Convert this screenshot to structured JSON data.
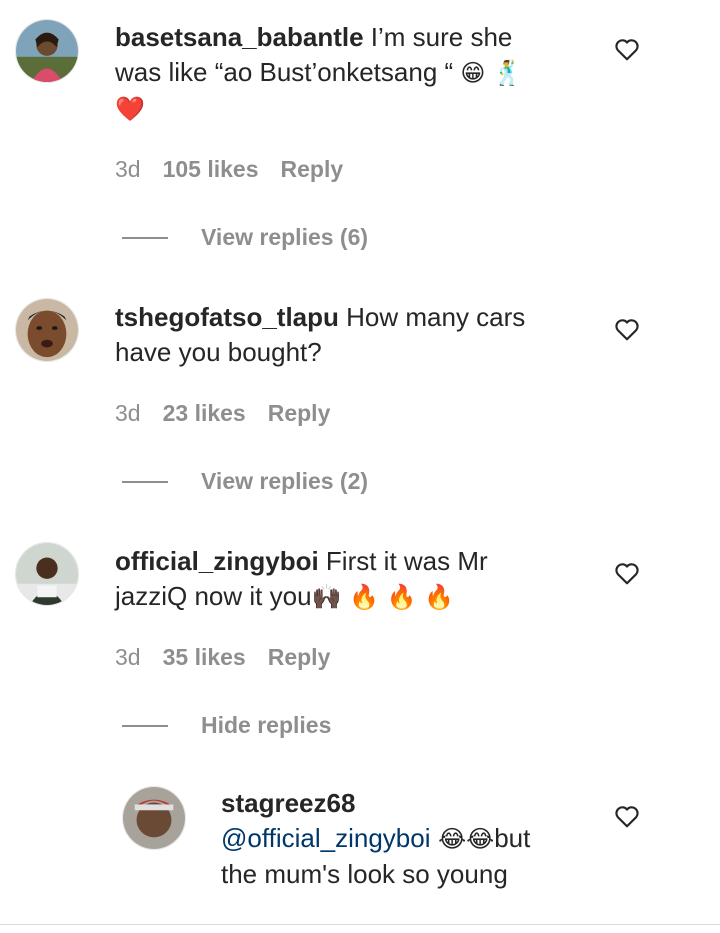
{
  "comments": [
    {
      "username": "basetsana_babantle",
      "text_line1": " I’m sure she",
      "text_line2": "was like “ao Bust’onketsang “ ",
      "emoji1": "😁",
      "emoji2": "🕺",
      "emoji3": "❤️",
      "age": "3d",
      "likes": "105 likes",
      "reply": "Reply",
      "replies_toggle": "View replies (6)"
    },
    {
      "username": "tshegofatso_tlapu",
      "text_line1": " How many cars",
      "text_line2": "have you bought?",
      "age": "3d",
      "likes": "23 likes",
      "reply": "Reply",
      "replies_toggle": "View replies (2)"
    },
    {
      "username": "official_zingyboi",
      "text_line1": " First it was Mr",
      "text_line2": "jazziQ now it you",
      "emoji": "🙌🏿 🔥 🔥 🔥",
      "age": "3d",
      "likes": "35 likes",
      "reply": "Reply",
      "replies_toggle": "Hide replies"
    }
  ],
  "reply": {
    "username": "stagreez68",
    "mention": "@official_zingyboi",
    "emoji": " 😂😂",
    "text_line1_tail": "but",
    "text_line2": "the mum's look so young"
  }
}
